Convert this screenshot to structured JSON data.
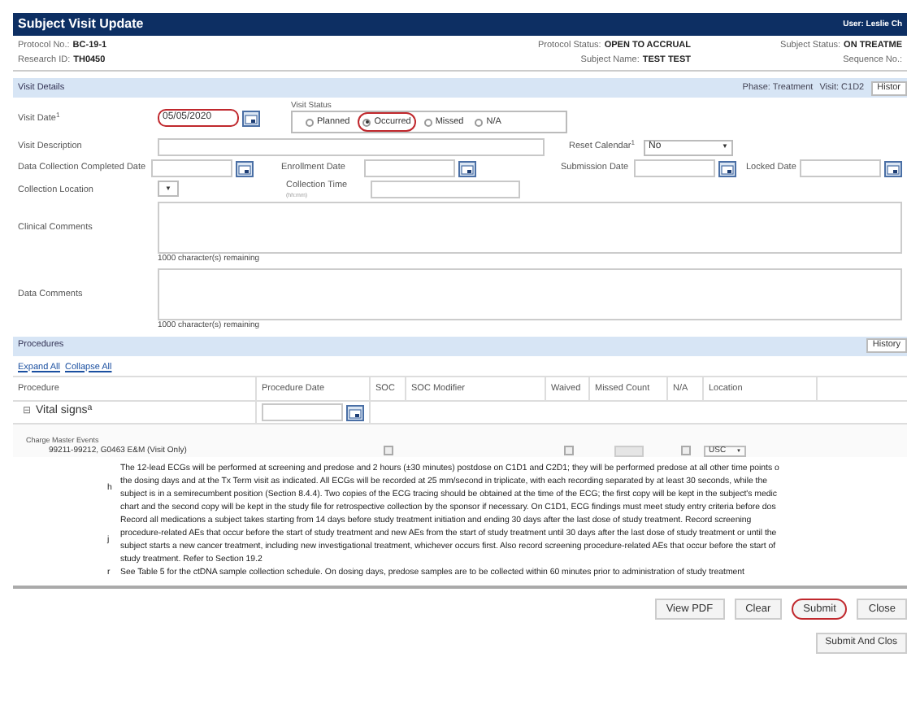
{
  "header": {
    "title": "Subject Visit Update",
    "user": "User: Leslie Ch"
  },
  "info": [
    {
      "label": "Protocol No.:",
      "value": "BC-19-1"
    },
    {
      "label": "Protocol Status:",
      "value": "OPEN TO ACCRUAL"
    },
    {
      "label": "Subject Status:",
      "value": "ON TREATME"
    },
    {
      "label": "Research ID:",
      "value": "TH0450"
    },
    {
      "label": "Subject Name:",
      "value": "TEST TEST"
    },
    {
      "label": "Sequence No.:"
    }
  ],
  "visit_bar": {
    "title": "Visit Details",
    "phase": "Phase: Treatment",
    "visit": "Visit: C1D2",
    "history": "Histor"
  },
  "visit_date": {
    "label": "Visit Date",
    "note": "1",
    "value": "05/05/2020",
    "highlighted": true
  },
  "visit_status": {
    "label": "Visit Status",
    "options": [
      {
        "label": "Planned",
        "selected": false,
        "highlighted": false
      },
      {
        "label": "Occurred",
        "selected": true,
        "highlighted": true
      },
      {
        "label": "Missed",
        "selected": false,
        "highlighted": false
      },
      {
        "label": "N/A",
        "selected": false,
        "highlighted": false
      }
    ]
  },
  "visit_description": {
    "label": "Visit Description"
  },
  "reset_calendar": {
    "label": "Reset Calendar",
    "note": "1",
    "value": "No",
    "arrow": "▼"
  },
  "dates": [
    {
      "label": "Data Collection Completed Date"
    },
    {
      "label": "Enrollment Date"
    },
    {
      "label": "Submission Date"
    },
    {
      "label": "Locked Date"
    }
  ],
  "collection_location": {
    "label": "Collection Location",
    "arrow": "▼"
  },
  "collection_time": {
    "label": "Collection Time",
    "hint": "(hh:mm)"
  },
  "comments": [
    {
      "label": "Clinical Comments",
      "remaining": "1000 character(s) remaining"
    },
    {
      "label": "Data Comments",
      "remaining": "1000 character(s) remaining"
    }
  ],
  "procedures_bar": {
    "title": "Procedures",
    "history": "History"
  },
  "links": [
    "Expand All",
    "Collapse All"
  ],
  "table": {
    "columns": [
      "Procedure",
      "Procedure Date",
      "SOC",
      "SOC Modifier",
      "Waived",
      "Missed Count",
      "N/A",
      "Location"
    ],
    "group": {
      "toggle": "⊟",
      "name": "Vital signs",
      "note": "a"
    },
    "subheader": "Charge Master Events",
    "row": {
      "name": "99211-99212, G0463 E&M (Visit Only)",
      "soc": false,
      "waived": false,
      "na": false,
      "location": "USC",
      "arrow": "▼"
    }
  },
  "footnotes": [
    {
      "mark": "h",
      "lines": [
        "The 12-lead ECGs will be performed at screening and predose and 2 hours (±30 minutes) postdose on C1D1 and C2D1; they will be performed predose at all other time points o",
        "the dosing days and at the Tx Term visit as indicated. All ECGs will be recorded at 25 mm/second in triplicate, with each recording separated by at least 30 seconds, while the",
        "subject is in a semirecumbent position (Section 8.4.4). Two copies of the ECG tracing should be obtained at the time of the ECG; the first copy will be kept in the subject's medic",
        "chart and the second copy will be kept in the study file for retrospective collection by the sponsor if necessary. On C1D1, ECG findings must meet study entry criteria before dos"
      ]
    },
    {
      "mark": "j",
      "lines": [
        "Record all medications a subject takes starting from 14 days before study treatment initiation and ending 30 days after the last dose of study treatment. Record screening",
        "procedure-related AEs that occur before the start of study treatment and new AEs from the start of study treatment until 30 days after the last dose of study treatment or until the",
        "subject starts a new cancer treatment, including new investigational treatment, whichever occurs first. Also record screening procedure-related AEs that occur before the start of",
        "study treatment. Refer to Section 19.2"
      ]
    },
    {
      "mark": "r",
      "lines": [
        "See Table 5 for the ctDNA sample collection schedule. On dosing days, predose samples are to be collected within 60 minutes prior to administration of study treatment"
      ]
    }
  ],
  "buttons": [
    {
      "label": "View PDF",
      "highlighted": false
    },
    {
      "label": "Clear",
      "highlighted": false
    },
    {
      "label": "Submit",
      "highlighted": true
    },
    {
      "label": "Close",
      "highlighted": false
    }
  ],
  "bottom_button": "Submit And Clos"
}
